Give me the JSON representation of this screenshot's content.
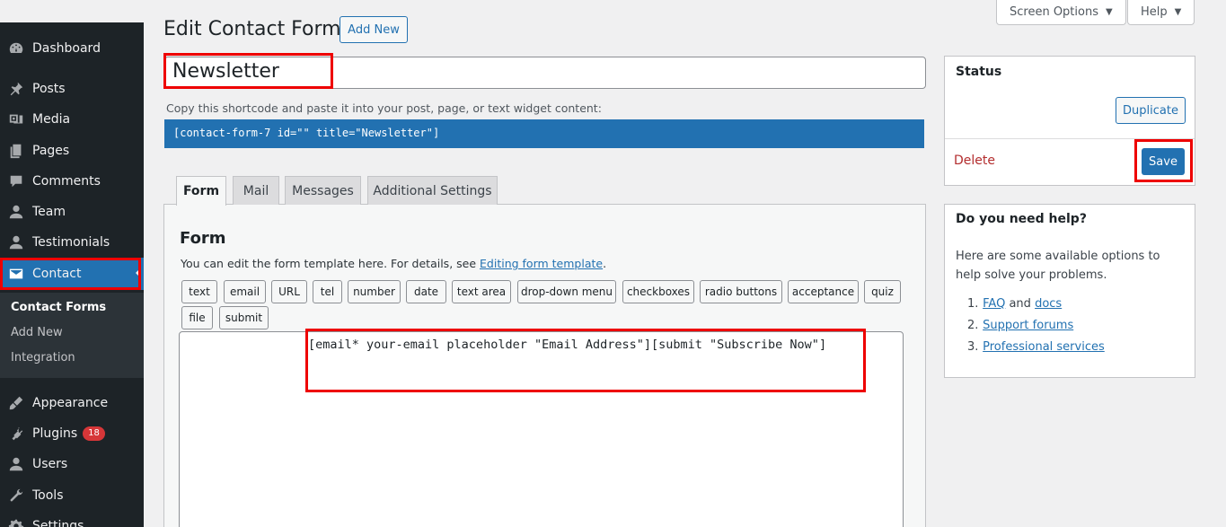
{
  "sidebar": {
    "items": [
      {
        "label": "Dashboard",
        "icon": "dashboard-icon"
      },
      {
        "label": "Posts",
        "icon": "pin-icon"
      },
      {
        "label": "Media",
        "icon": "media-icon"
      },
      {
        "label": "Pages",
        "icon": "pages-icon"
      },
      {
        "label": "Comments",
        "icon": "comments-icon"
      },
      {
        "label": "Team",
        "icon": "user-icon"
      },
      {
        "label": "Testimonials",
        "icon": "user-icon"
      },
      {
        "label": "Contact",
        "icon": "envelope-icon"
      },
      {
        "label": "Appearance",
        "icon": "brush-icon"
      },
      {
        "label": "Plugins",
        "icon": "plug-icon",
        "badge": "18"
      },
      {
        "label": "Users",
        "icon": "user-icon"
      },
      {
        "label": "Tools",
        "icon": "wrench-icon"
      },
      {
        "label": "Settings",
        "icon": "gear-icon"
      }
    ],
    "submenu": [
      "Contact Forms",
      "Add New",
      "Integration"
    ]
  },
  "header": {
    "title": "Edit Contact Form",
    "add_new": "Add New",
    "screen_options": "Screen Options",
    "help": "Help"
  },
  "form": {
    "title_value": "Newsletter",
    "shortcode_hint": "Copy this shortcode and paste it into your post, page, or text widget content:",
    "shortcode": "[contact-form-7 id=\"\" title=\"Newsletter\"]",
    "tabs": [
      "Form",
      "Mail",
      "Messages",
      "Additional Settings"
    ],
    "heading": "Form",
    "desc_before": "You can edit the form template here. For details, see ",
    "desc_link": "Editing form template",
    "desc_after": ".",
    "tag_buttons": [
      "text",
      "email",
      "URL",
      "tel",
      "number",
      "date",
      "text area",
      "drop-down menu",
      "checkboxes",
      "radio buttons",
      "acceptance",
      "quiz",
      "file",
      "submit"
    ],
    "template": "[email* your-email placeholder \"Email Address\"][submit \"Subscribe Now\"]"
  },
  "status": {
    "title": "Status",
    "duplicate": "Duplicate",
    "delete": "Delete",
    "save": "Save"
  },
  "help_box": {
    "title": "Do you need help?",
    "text": "Here are some available options to help solve your problems.",
    "n1": "1.",
    "faq": "FAQ",
    "and": " and ",
    "docs": "docs",
    "n2": "2.",
    "support": "Support forums",
    "n3": "3.",
    "professional": "Professional services"
  },
  "colors": {
    "accent": "#2271b1",
    "sidebar_bg": "#1d2327",
    "highlight": "#e00000",
    "delete": "#b32d2e",
    "badge": "#d63638"
  }
}
